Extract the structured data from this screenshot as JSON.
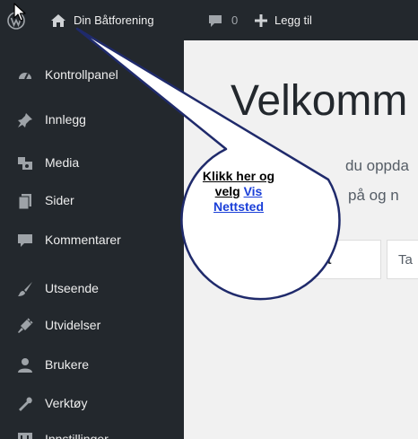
{
  "adminbar": {
    "site_name": "Din Båtforening",
    "comments_count": "0",
    "new_label": "Legg til",
    "icons": [
      "wordpress-icon",
      "home-icon",
      "comment-icon",
      "plus-icon"
    ]
  },
  "sidebar": {
    "items": [
      {
        "label": "Kontrollpanel",
        "icon": "dashboard-icon"
      },
      {
        "label": "Innlegg",
        "icon": "pin-icon"
      },
      {
        "label": "Media",
        "icon": "media-icon"
      },
      {
        "label": "Sider",
        "icon": "page-icon"
      },
      {
        "label": "Kommentarer",
        "icon": "comment-icon"
      },
      {
        "label": "Utseende",
        "icon": "brush-icon"
      },
      {
        "label": "Utvidelser",
        "icon": "plugin-icon"
      },
      {
        "label": "Brukere",
        "icon": "users-icon"
      },
      {
        "label": "Verktøy",
        "icon": "wrench-icon"
      },
      {
        "label": "Innstillinger",
        "icon": "settings-icon"
      }
    ]
  },
  "main": {
    "title": "Velkomm",
    "line1": "du oppda",
    "line2": "på og n",
    "tabs": [
      {
        "label": "nytt"
      },
      {
        "label": "Ta"
      }
    ]
  },
  "callout": {
    "line1": "Klikk her og",
    "line2_plain": "velg",
    "line2_link": "Vis",
    "line3_link": "Nettsted"
  },
  "colors": {
    "sidebar_bg": "#23282d",
    "content_bg": "#f1f1f1",
    "callout_border": "#1f2a6b",
    "link": "#1a3fd8"
  }
}
